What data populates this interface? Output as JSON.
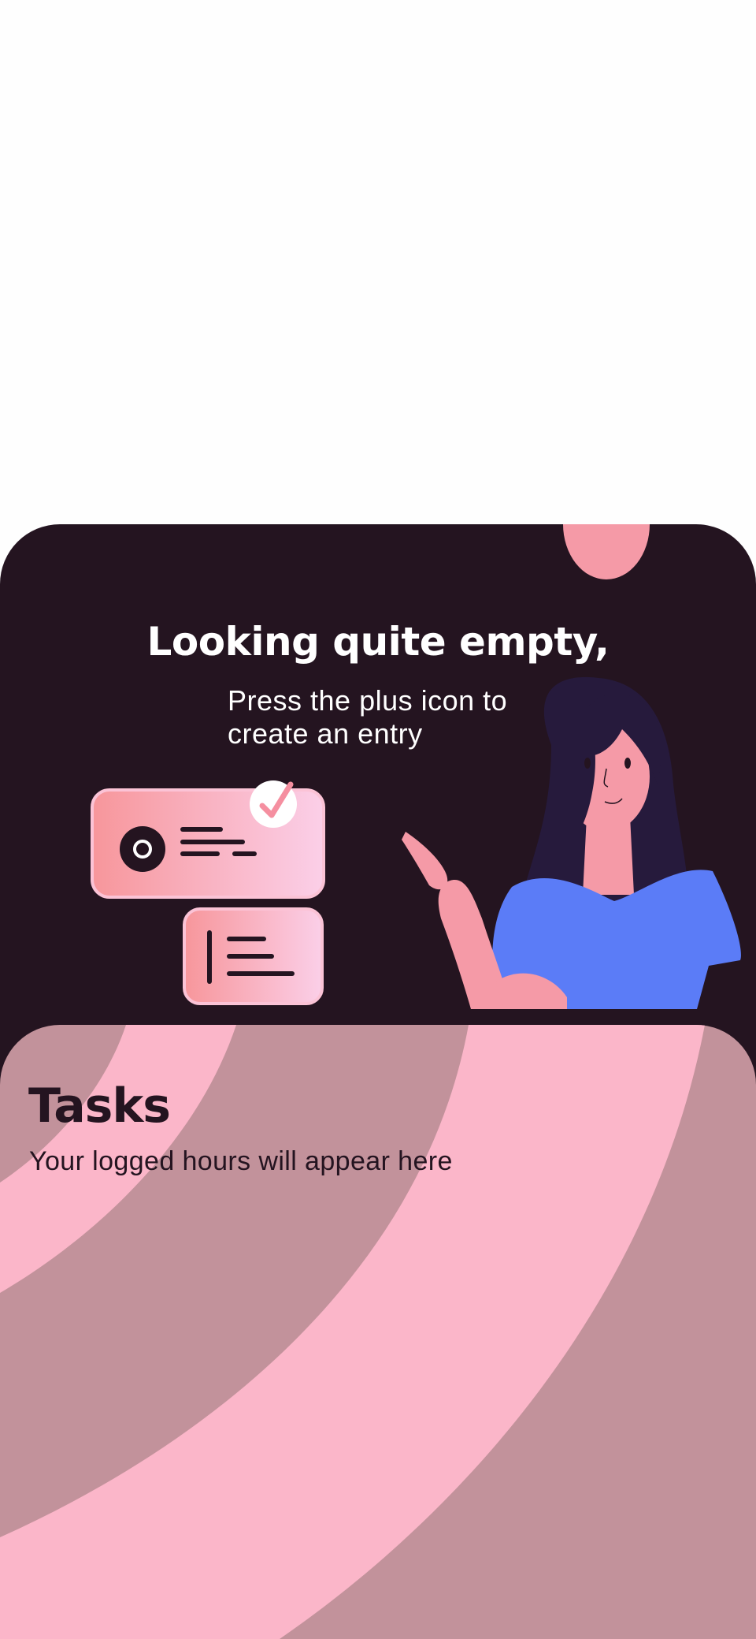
{
  "empty_state": {
    "title": "Looking quite empty,",
    "subtitle": "Press the plus icon to\ncreate an entry",
    "illustration_icons": [
      "task-card-icon",
      "checkmark-icon",
      "text-lines-icon",
      "pointing-woman-illustration"
    ]
  },
  "tasks": {
    "title": "Tasks",
    "subtitle": "Your logged hours will appear here"
  },
  "colors": {
    "background": "#fefefe",
    "empty_card": "#241420",
    "sheet_base": "#c2929b",
    "sheet_band": "#fbb6c9",
    "text_dark": "#241420",
    "text_light": "#ffffff",
    "accent_pink": "#f7a1a8",
    "shirt_blue": "#5b7cf7"
  }
}
